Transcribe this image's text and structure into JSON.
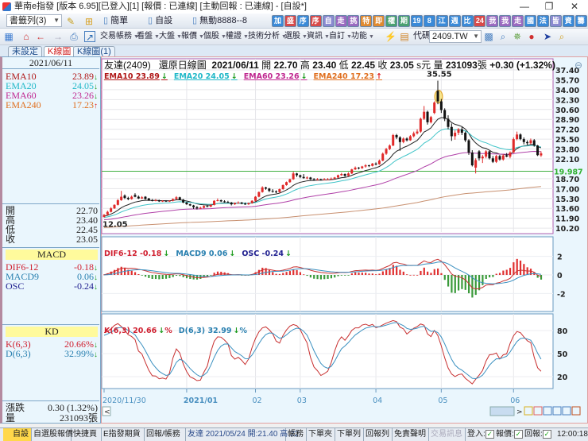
{
  "window": {
    "title": "華南e指發 [版本 6.95][已登入][1] [報價 : 已連線] [主動回報 : 已連線] - [自設*]",
    "minimize": "—",
    "restore": "❐",
    "close": "✕"
  },
  "toolbar1": {
    "bookmark_combo": "書籤列(3)",
    "pages": [
      "簡單",
      "自設",
      "無動8888--8"
    ],
    "quick_icons": [
      {
        "t": "加",
        "c": "#3a8ad8"
      },
      {
        "t": "盛",
        "c": "#d84a4a"
      },
      {
        "t": "序",
        "c": "#3a8ad8"
      },
      {
        "t": "序",
        "c": "#d84a4a"
      },
      {
        "t": "自",
        "c": "#8a8ad0"
      },
      {
        "t": "走",
        "c": "#9a6ac0"
      },
      {
        "t": "挑",
        "c": "#9a6ac0"
      },
      {
        "t": "特",
        "c": "#e08a30"
      },
      {
        "t": "即",
        "c": "#e08a30"
      },
      {
        "t": "權",
        "c": "#4aa070"
      },
      {
        "t": "期",
        "c": "#4aa070"
      },
      {
        "t": "19",
        "c": "#3a8ad8"
      },
      {
        "t": "8",
        "c": "#3a8ad8"
      },
      {
        "t": "江",
        "c": "#3a8ad8"
      },
      {
        "t": "週",
        "c": "#3a8ad8"
      },
      {
        "t": "比",
        "c": "#3a8ad8"
      },
      {
        "t": "24",
        "c": "#d84a4a"
      },
      {
        "t": "我",
        "c": "#9a6ac0"
      },
      {
        "t": "我",
        "c": "#9a6ac0"
      },
      {
        "t": "走",
        "c": "#9a6ac0"
      },
      {
        "t": "國",
        "c": "#3a8ad8"
      },
      {
        "t": "法",
        "c": "#3a8ad8"
      },
      {
        "t": "皆",
        "c": "#8a8ad0"
      },
      {
        "t": "資",
        "c": "#3a8ad8"
      },
      {
        "t": "籌",
        "c": "#3a8ad8"
      }
    ]
  },
  "toolbar2": {
    "menus": [
      "交易帳務",
      "看盤",
      "大盤",
      "報價",
      "個股",
      "權證",
      "技術分析",
      "選股",
      "資訊",
      "自訂",
      "功能"
    ],
    "code_label": "代碼",
    "code_value": "2409.TW"
  },
  "tabs": [
    "未設定",
    "K線圖",
    "K線圖(1)"
  ],
  "left": {
    "date": "2021/06/11",
    "ema": [
      {
        "name": "EMA10",
        "value": "23.89",
        "dir": "down",
        "color": "#b01818"
      },
      {
        "name": "EMA20",
        "value": "24.05",
        "dir": "down",
        "color": "#20b8c8"
      },
      {
        "name": "EMA60",
        "value": "23.26",
        "dir": "down",
        "color": "#c02890"
      },
      {
        "name": "EMA240",
        "value": "17.23",
        "dir": "up",
        "color": "#e07020"
      }
    ],
    "ohlc": [
      {
        "name": "開",
        "value": "22.70"
      },
      {
        "name": "高",
        "value": "23.40"
      },
      {
        "name": "低",
        "value": "22.45"
      },
      {
        "name": "收",
        "value": "23.05"
      }
    ],
    "macd_title": "MACD",
    "macd": [
      {
        "name": "DIF6-12",
        "value": "-0.18",
        "color": "#d02030"
      },
      {
        "name": "MACD9",
        "value": "0.06",
        "color": "#2a80b0"
      },
      {
        "name": "OSC",
        "value": "-0.24",
        "color": "#202090"
      }
    ],
    "kd_title": "KD",
    "kd": [
      {
        "name": "K(6,3)",
        "value": "20.66%",
        "color": "#d02030"
      },
      {
        "name": "D(6,3)",
        "value": "32.99%",
        "color": "#2a80b0"
      }
    ],
    "change_label": "漲跌",
    "change_value": "0.30 (1.32%)",
    "volume_label": "量",
    "volume_value": "231093張"
  },
  "chart_header": {
    "stock": "友達(2409)",
    "type": "還原日線圖",
    "date": "2021/06/11",
    "open_l": "開",
    "open": "22.70",
    "high_l": "高",
    "high": "23.40",
    "low_l": "低",
    "low": "22.45",
    "close_l": "收",
    "close": "23.05",
    "unit": "s元",
    "vol_l": "量",
    "vol": "231093",
    "vol_unit": "張",
    "change": "+0.30 (+1.32%)"
  },
  "legend_main": [
    "EMA10 23.89",
    "EMA20 24.05",
    "EMA60 23.26",
    "EMA240 17.23"
  ],
  "legend_main_dirs": [
    "↓",
    "↓",
    "↓",
    "↑"
  ],
  "legend_macd": [
    "DIF6-12 -0.18",
    "MACD9 0.06",
    "OSC -0.24"
  ],
  "legend_kd": [
    "K(6,3) 20.66",
    "D(6,3) 32.99"
  ],
  "status": {
    "tabs": [
      "自設",
      "自選股報價",
      "快捷頁",
      "E指發期貨",
      "回報/帳務"
    ],
    "ticker": "友達 2021/05/24 開:21.40 高:22",
    "buttons": [
      "帳務",
      "下單夾",
      "下單列",
      "回報列",
      "免責聲明",
      "交易訊息"
    ],
    "login": "登入:",
    "quote": "報價:",
    "report": "回報:",
    "time": "12:00:18"
  },
  "chart_data": {
    "type": "candlestick",
    "price_axis": {
      "ticks": [
        "37.40",
        "35.70",
        "34.00",
        "32.30",
        "30.60",
        "28.90",
        "27.20",
        "25.50",
        "23.80",
        "22.10",
        "18.70",
        "17.00",
        "15.30",
        "13.60",
        "11.90",
        "10.20"
      ],
      "range": [
        10.2,
        37.4
      ],
      "reference_line": "19.987"
    },
    "annotations": {
      "high": "35.55",
      "low": "12.05"
    },
    "date_labels": [
      "2020/11/30",
      "2021/01",
      "02",
      "03",
      "04",
      "05",
      "06"
    ],
    "macd_axis": [
      "2",
      "0",
      "-2"
    ],
    "kd_axis": [
      "80",
      "50",
      "20"
    ],
    "colors": {
      "up": "#e02828",
      "down": "#111111",
      "ema10": "#222222",
      "ema20": "#40c4c8",
      "ema60": "#b040a8",
      "ema240": "#c89070",
      "dif": "#c83030",
      "macd": "#3a90c0",
      "osc_pos": "#e03030",
      "osc_neg": "#3a9a3a",
      "k": "#c83030",
      "d": "#3a90c0"
    },
    "ohlc": [
      [
        12.1,
        12.6,
        12.05,
        12.5
      ],
      [
        12.5,
        13.2,
        12.4,
        13.0
      ],
      [
        13.0,
        13.8,
        12.9,
        13.6
      ],
      [
        13.6,
        14.3,
        13.5,
        14.2
      ],
      [
        14.2,
        15.2,
        14.1,
        15.0
      ],
      [
        15.0,
        16.6,
        14.9,
        15.6
      ],
      [
        15.8,
        16.0,
        15.2,
        15.4
      ],
      [
        15.4,
        15.6,
        15.0,
        15.2
      ],
      [
        15.2,
        15.8,
        15.1,
        15.6
      ],
      [
        15.9,
        16.2,
        15.5,
        15.6
      ],
      [
        15.6,
        15.8,
        15.2,
        15.3
      ],
      [
        15.3,
        15.7,
        15.2,
        15.5
      ],
      [
        15.6,
        15.7,
        15.1,
        15.2
      ],
      [
        15.3,
        15.4,
        14.9,
        15.0
      ],
      [
        15.0,
        15.2,
        14.8,
        14.9
      ],
      [
        14.9,
        15.2,
        14.8,
        15.0
      ],
      [
        15.0,
        15.1,
        14.7,
        14.8
      ],
      [
        14.8,
        15.0,
        14.7,
        14.9
      ],
      [
        14.9,
        15.0,
        14.7,
        14.8
      ],
      [
        14.8,
        15.0,
        14.7,
        14.9
      ],
      [
        14.9,
        15.3,
        14.8,
        15.2
      ],
      [
        15.2,
        15.7,
        15.1,
        15.5
      ],
      [
        15.5,
        15.6,
        15.0,
        15.1
      ],
      [
        15.1,
        15.2,
        14.5,
        14.6
      ],
      [
        14.6,
        14.7,
        14.2,
        14.3
      ],
      [
        14.3,
        14.4,
        14.0,
        14.1
      ],
      [
        14.1,
        14.2,
        13.5,
        13.8
      ],
      [
        13.8,
        14.0,
        13.4,
        13.6
      ],
      [
        13.6,
        13.9,
        13.5,
        13.7
      ],
      [
        13.7,
        14.1,
        13.6,
        14.0
      ],
      [
        14.0,
        14.2,
        13.8,
        13.9
      ],
      [
        13.9,
        14.3,
        13.8,
        14.2
      ],
      [
        14.2,
        15.0,
        14.1,
        14.9
      ],
      [
        14.9,
        15.3,
        14.8,
        15.0
      ],
      [
        15.0,
        15.1,
        14.7,
        14.8
      ],
      [
        14.8,
        15.0,
        14.6,
        14.7
      ],
      [
        14.7,
        14.9,
        14.5,
        14.6
      ],
      [
        14.6,
        14.7,
        14.1,
        14.3
      ],
      [
        14.3,
        14.6,
        14.2,
        14.5
      ],
      [
        14.5,
        14.8,
        14.4,
        14.6
      ],
      [
        14.6,
        14.7,
        14.3,
        14.4
      ],
      [
        14.4,
        14.6,
        14.2,
        14.3
      ],
      [
        14.3,
        14.6,
        14.2,
        14.5
      ],
      [
        14.5,
        15.0,
        14.4,
        14.9
      ],
      [
        14.9,
        15.7,
        14.8,
        15.6
      ],
      [
        15.6,
        16.5,
        15.5,
        16.4
      ],
      [
        16.4,
        17.4,
        16.3,
        17.2
      ],
      [
        17.2,
        17.3,
        16.8,
        17.0
      ],
      [
        17.0,
        17.1,
        16.4,
        16.6
      ],
      [
        16.6,
        16.9,
        16.3,
        16.5
      ],
      [
        16.5,
        16.7,
        16.2,
        16.4
      ],
      [
        16.4,
        17.0,
        16.3,
        16.9
      ],
      [
        16.9,
        17.7,
        16.8,
        17.6
      ],
      [
        17.6,
        18.2,
        17.5,
        18.1
      ],
      [
        18.1,
        18.7,
        18.0,
        18.6
      ],
      [
        18.6,
        19.9,
        18.5,
        19.6
      ],
      [
        19.6,
        19.7,
        19.0,
        19.3
      ],
      [
        19.3,
        19.4,
        18.8,
        19.0
      ],
      [
        19.0,
        19.5,
        18.7,
        18.8
      ],
      [
        18.8,
        19.1,
        18.6,
        18.9
      ],
      [
        18.9,
        19.0,
        18.5,
        18.6
      ],
      [
        18.6,
        18.8,
        18.4,
        18.5
      ],
      [
        18.5,
        18.8,
        18.4,
        18.6
      ],
      [
        18.6,
        18.7,
        18.4,
        18.5
      ],
      [
        18.5,
        18.8,
        18.4,
        18.6
      ],
      [
        18.6,
        18.8,
        18.5,
        18.6
      ],
      [
        18.6,
        18.9,
        18.5,
        18.7
      ],
      [
        18.7,
        19.0,
        18.6,
        18.9
      ],
      [
        18.9,
        19.4,
        18.8,
        19.3
      ],
      [
        19.3,
        19.7,
        19.2,
        19.5
      ],
      [
        19.5,
        19.6,
        19.0,
        19.2
      ],
      [
        19.2,
        19.8,
        19.1,
        19.6
      ],
      [
        19.6,
        20.4,
        19.5,
        20.3
      ],
      [
        20.3,
        20.8,
        20.2,
        20.6
      ],
      [
        20.6,
        20.7,
        20.3,
        20.5
      ],
      [
        20.5,
        20.9,
        20.4,
        20.8
      ],
      [
        20.8,
        21.2,
        20.6,
        21.0
      ],
      [
        21.0,
        21.1,
        20.7,
        20.9
      ],
      [
        20.9,
        21.4,
        20.8,
        21.3
      ],
      [
        21.3,
        21.5,
        21.0,
        21.2
      ],
      [
        21.2,
        22.0,
        21.1,
        21.8
      ],
      [
        21.8,
        23.2,
        21.7,
        23.0
      ],
      [
        23.0,
        24.0,
        22.8,
        23.8
      ],
      [
        23.8,
        24.6,
        23.6,
        24.4
      ],
      [
        24.4,
        26.4,
        24.3,
        26.2
      ],
      [
        26.2,
        26.4,
        25.5,
        25.8
      ],
      [
        25.8,
        26.0,
        23.5,
        25.0
      ],
      [
        25.0,
        25.8,
        24.8,
        25.6
      ],
      [
        25.6,
        25.8,
        25.1,
        25.3
      ],
      [
        25.3,
        26.2,
        25.2,
        26.0
      ],
      [
        26.0,
        26.8,
        25.8,
        26.5
      ],
      [
        26.5,
        27.2,
        26.3,
        26.8
      ],
      [
        26.8,
        29.2,
        26.6,
        29.0
      ],
      [
        29.0,
        31.2,
        28.8,
        30.2
      ],
      [
        30.2,
        30.4,
        28.0,
        28.4
      ],
      [
        28.4,
        29.5,
        28.2,
        29.3
      ],
      [
        30.0,
        32.0,
        29.8,
        31.8
      ],
      [
        33.8,
        35.55,
        31.5,
        32.0
      ],
      [
        32.0,
        32.4,
        30.0,
        30.5
      ],
      [
        30.5,
        30.8,
        28.6,
        29.0
      ],
      [
        29.0,
        29.6,
        27.2,
        27.6
      ],
      [
        27.6,
        28.2,
        25.2,
        26.0
      ],
      [
        26.0,
        27.0,
        25.4,
        26.6
      ],
      [
        26.6,
        27.4,
        26.2,
        27.2
      ],
      [
        27.2,
        27.6,
        26.2,
        26.6
      ],
      [
        26.6,
        26.8,
        25.0,
        25.3
      ],
      [
        25.3,
        25.5,
        22.8,
        23.2
      ],
      [
        23.2,
        23.6,
        20.8,
        21.0
      ],
      [
        20.6,
        22.2,
        19.6,
        21.9
      ],
      [
        23.4,
        23.6,
        21.8,
        22.2
      ],
      [
        22.2,
        22.8,
        21.4,
        22.5
      ],
      [
        22.5,
        23.6,
        22.2,
        23.4
      ],
      [
        23.4,
        23.5,
        22.0,
        22.2
      ],
      [
        22.2,
        22.6,
        21.4,
        21.6
      ],
      [
        21.6,
        22.8,
        21.4,
        22.6
      ],
      [
        22.6,
        22.8,
        21.8,
        22.0
      ],
      [
        22.0,
        22.9,
        21.8,
        22.7
      ],
      [
        22.7,
        23.1,
        22.4,
        22.5
      ],
      [
        22.5,
        23.4,
        22.2,
        23.2
      ],
      [
        23.2,
        25.8,
        23.1,
        25.5
      ],
      [
        25.5,
        26.8,
        25.3,
        26.3
      ],
      [
        26.3,
        26.5,
        25.3,
        25.5
      ],
      [
        25.5,
        25.8,
        24.6,
        25.0
      ],
      [
        25.0,
        25.3,
        24.5,
        24.8
      ],
      [
        24.8,
        25.6,
        24.6,
        25.3
      ],
      [
        25.3,
        25.5,
        24.2,
        24.4
      ],
      [
        24.4,
        24.5,
        22.6,
        22.75
      ],
      [
        22.7,
        23.4,
        22.45,
        23.05
      ]
    ]
  }
}
